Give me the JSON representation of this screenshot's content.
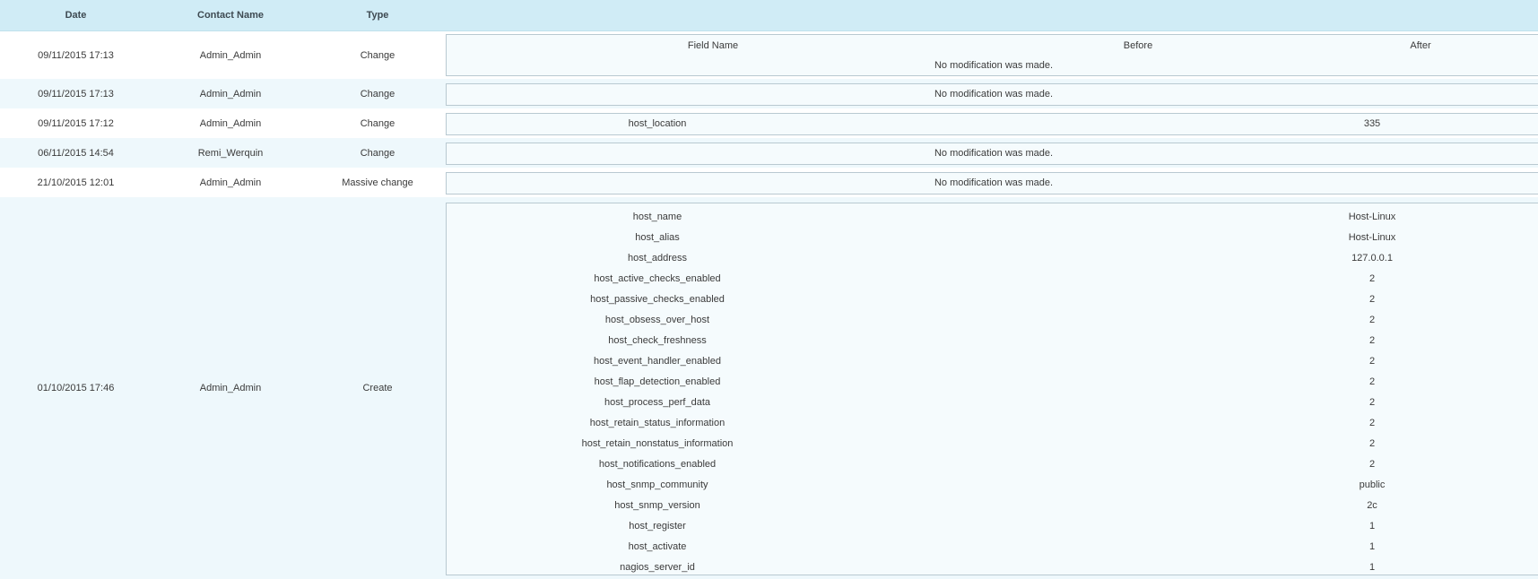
{
  "header": {
    "date": "Date",
    "contact": "Contact Name",
    "type": "Type"
  },
  "rows": [
    {
      "date": "09/11/2015 17:13",
      "contact": "Admin_Admin",
      "type": "Change",
      "field_headers": {
        "field": "Field Name",
        "before": "Before",
        "after": "After"
      },
      "message": "No modification was made."
    },
    {
      "date": "09/11/2015 17:13",
      "contact": "Admin_Admin",
      "type": "Change",
      "message": "No modification was made."
    },
    {
      "date": "09/11/2015 17:12",
      "contact": "Admin_Admin",
      "type": "Change",
      "field": "host_location",
      "after": "335"
    },
    {
      "date": "06/11/2015 14:54",
      "contact": "Remi_Werquin",
      "type": "Change",
      "message": "No modification was made."
    },
    {
      "date": "21/10/2015 12:01",
      "contact": "Admin_Admin",
      "type": "Massive change",
      "message": "No modification was made."
    },
    {
      "date": "01/10/2015 17:46",
      "contact": "Admin_Admin",
      "type": "Create",
      "fields": [
        {
          "field": "host_name",
          "after": "Host-Linux"
        },
        {
          "field": "host_alias",
          "after": "Host-Linux"
        },
        {
          "field": "host_address",
          "after": "127.0.0.1"
        },
        {
          "field": "host_active_checks_enabled",
          "after": "2"
        },
        {
          "field": "host_passive_checks_enabled",
          "after": "2"
        },
        {
          "field": "host_obsess_over_host",
          "after": "2"
        },
        {
          "field": "host_check_freshness",
          "after": "2"
        },
        {
          "field": "host_event_handler_enabled",
          "after": "2"
        },
        {
          "field": "host_flap_detection_enabled",
          "after": "2"
        },
        {
          "field": "host_process_perf_data",
          "after": "2"
        },
        {
          "field": "host_retain_status_information",
          "after": "2"
        },
        {
          "field": "host_retain_nonstatus_information",
          "after": "2"
        },
        {
          "field": "host_notifications_enabled",
          "after": "2"
        },
        {
          "field": "host_snmp_community",
          "after": "public"
        },
        {
          "field": "host_snmp_version",
          "after": "2c"
        },
        {
          "field": "host_register",
          "after": "1"
        },
        {
          "field": "host_activate",
          "after": "1"
        },
        {
          "field": "nagios_server_id",
          "after": "1"
        }
      ]
    }
  ],
  "colors": {
    "header_bg": "#d0ecf6",
    "row_tint": "#eef8fc",
    "box_bg": "#f5fbfd",
    "box_border": "#b9c9d1"
  }
}
